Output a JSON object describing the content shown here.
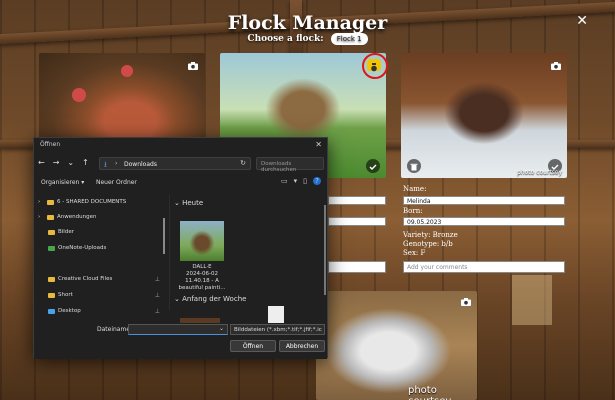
{
  "app": {
    "title": "Flock Manager",
    "choose_label": "Choose a flock:",
    "flock_selected": "Flock 1",
    "close_glyph": "✕"
  },
  "cards": {
    "photo_credit_small": "photo courtsey",
    "photo_credit_large": "photo courtsey",
    "camera_icon": "camera-icon",
    "check_icon": "check-icon",
    "trash_icon": "trash-icon",
    "highlight_color": "#e01515",
    "camera_active_color": "#f3c400"
  },
  "bird": {
    "name_label": "Name:",
    "name_value": "Melinda",
    "born_label": "Born:",
    "born_value": "09.05.2023",
    "variety": "Variety: Bronze",
    "genotype": "Genotype: b/b",
    "sex": "Sex: F",
    "comment_placeholder": "Add your comments"
  },
  "dialog": {
    "title": "Öffnen",
    "close": "✕",
    "nav": {
      "back": "←",
      "forward": "→",
      "dropdown": "⌄",
      "up": "↑"
    },
    "path": "Downloads",
    "breadcrumb_sep": "›",
    "refresh": "↻",
    "search_placeholder": "Downloads durchsuchen",
    "toolbar": {
      "organize": "Organisieren ▾",
      "new_folder": "Neuer Ordner",
      "help": "?"
    },
    "sidebar": [
      {
        "label": "6 - SHARED DOCUMENTS",
        "color": "#e8b93b",
        "chevron": "›"
      },
      {
        "label": "Anwendungen",
        "color": "#e8b93b",
        "chevron": "›"
      },
      {
        "label": "Bilder",
        "color": "#e8b93b",
        "chevron": ""
      },
      {
        "label": "OneNote-Uploads",
        "color": "#4aa54a",
        "chevron": ""
      },
      {
        "label": "Creative Cloud Files",
        "color": "#e8b93b",
        "chevron": "",
        "pin": "📌"
      },
      {
        "label": "Short",
        "color": "#e8b93b",
        "chevron": "",
        "pin": "📌"
      },
      {
        "label": "Desktop",
        "color": "#4aa3e8",
        "chevron": "",
        "pin": "📌"
      }
    ],
    "groups": {
      "today": "Heute",
      "start_of_week": "Anfang der Woche",
      "chevron": "⌄"
    },
    "file_caption": [
      "DALL·E",
      "2024-06-02",
      "11.40.18 - A",
      "beautiful painti..."
    ],
    "filename_label": "Dateiname:",
    "filename_value": "",
    "filter": "Bilddateien (*.xbm;*.tif;*.jfif;*.ic",
    "open_button": "Öffnen",
    "cancel_button": "Abbrechen"
  }
}
